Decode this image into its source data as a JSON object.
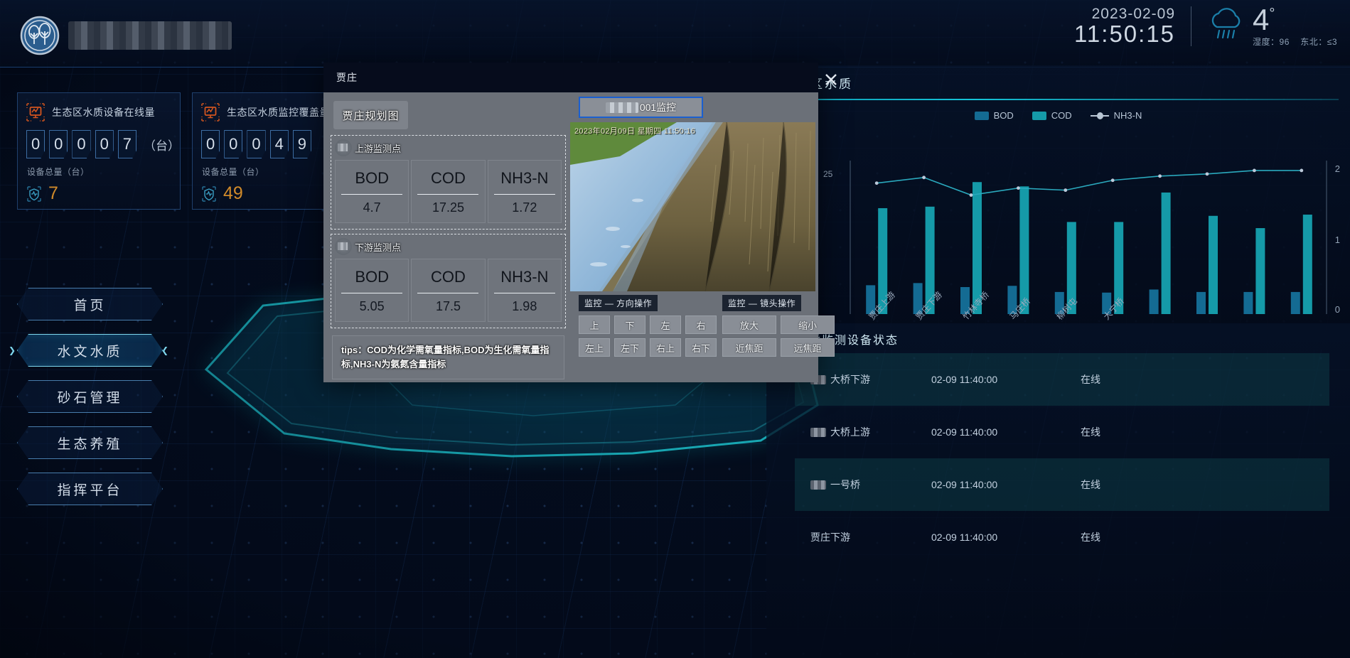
{
  "header": {
    "app_title": "",
    "logo_icon": "tree-logo-icon",
    "date": "2023-02-09",
    "time": "11:50:15",
    "weather_icon": "rain-cloud-icon",
    "temperature": "4",
    "degree": "°",
    "humidity": "湿度：96",
    "wind": "东北：≤3"
  },
  "stat_cards": [
    {
      "icon": "monitor-chart-icon",
      "title": "生态区水质设备在线量",
      "digits": [
        "0",
        "0",
        "0",
        "0",
        "7"
      ],
      "unit": "（台）",
      "sub_label": "设备总量（台）",
      "total_icon": "shield-pulse-icon",
      "total_value": "7"
    },
    {
      "icon": "monitor-chart-icon",
      "title": "生态区水质监控覆盖量",
      "digits": [
        "0",
        "0",
        "0",
        "4",
        "9"
      ],
      "unit": "（台）",
      "sub_label": "设备总量（台）",
      "total_icon": "shield-pulse-icon",
      "total_value": "49"
    }
  ],
  "nav": {
    "items": [
      {
        "label": "首页",
        "active": false
      },
      {
        "label": "水文水质",
        "active": true
      },
      {
        "label": "砂石管理",
        "active": false
      },
      {
        "label": "生态养殖",
        "active": false
      },
      {
        "label": "指挥平台",
        "active": false
      }
    ],
    "arrow_left": "❯",
    "arrow_right": "❮"
  },
  "chart_panel": {
    "icon": "bar-chart-icon",
    "title": "库区水质"
  },
  "chart_data": {
    "type": "bar",
    "title": "库区水质",
    "categories": [
      "贾庄上游",
      "贾庄下游",
      "竹林寺桥",
      "竹林寺桥",
      "马庄桥",
      "马庄桥",
      "柳树屯",
      "柳树屯",
      "大宁桥",
      "大宁桥"
    ],
    "series": [
      {
        "name": "BOD",
        "type": "bar",
        "color": "#146b93",
        "values": [
          4.7,
          5.05,
          4.4,
          4.6,
          3.6,
          3.5,
          4.0,
          3.6,
          3.6,
          3.6
        ]
      },
      {
        "name": "COD",
        "type": "bar",
        "color": "#159aa8",
        "values": [
          17.25,
          17.5,
          21.5,
          20.8,
          15.0,
          15.0,
          19.8,
          16.0,
          14.0,
          16.2
        ]
      },
      {
        "name": "NH3-N",
        "type": "line",
        "color": "#2aa9bd",
        "values": [
          1.72,
          1.8,
          1.55,
          1.65,
          1.62,
          1.76,
          1.82,
          1.85,
          1.9,
          1.9
        ]
      }
    ],
    "ylabel_left": "25",
    "yleft_ticks": [
      "25"
    ],
    "yright_ticks": [
      "0",
      "1",
      "2"
    ],
    "ylim_right": [
      0,
      2
    ],
    "grid": false,
    "legend_position": "top-center",
    "legend": [
      "BOD",
      "COD",
      "NH3-N"
    ]
  },
  "table_panel": {
    "icon": "bar-chart-icon",
    "title": "水质监测设备状态",
    "rows": [
      {
        "name": "大桥下游",
        "time": "02-09 11:40:00",
        "state": "在线",
        "redacted": true
      },
      {
        "name": "大桥上游",
        "time": "02-09 11:40:00",
        "state": "在线",
        "redacted": true
      },
      {
        "name": "一号桥",
        "time": "02-09 11:40:00",
        "state": "在线",
        "redacted": true
      },
      {
        "name": "贾庄下游",
        "time": "02-09 11:40:00",
        "state": "在线",
        "redacted": false
      }
    ]
  },
  "modal": {
    "title": "贾庄",
    "close_icon": "close-icon",
    "plan_button": "贾庄规划图",
    "sections": [
      {
        "label": "上游监测点",
        "marker_icon": "map-pin-icon",
        "metrics": [
          {
            "name": "BOD",
            "value": "4.7"
          },
          {
            "name": "COD",
            "value": "17.25"
          },
          {
            "name": "NH3-N",
            "value": "1.72"
          }
        ]
      },
      {
        "label": "下游监测点",
        "marker_icon": "map-pin-icon",
        "metrics": [
          {
            "name": "BOD",
            "value": "5.05"
          },
          {
            "name": "COD",
            "value": "17.5"
          },
          {
            "name": "NH3-N",
            "value": "1.98"
          }
        ]
      }
    ],
    "tips": "tips：COD为化学需氧量指标,BOD为生化需氧量指标,NH3-N为氨氮含量指标",
    "camera": {
      "button_label": "001监控",
      "osd_text": "2023年02月09日 星期四 11:50:16",
      "direction_group_title": "监控 — 方向操作",
      "lens_group_title": "监控 — 镜头操作",
      "direction_buttons": [
        "上",
        "下",
        "左",
        "右",
        "左上",
        "左下",
        "右上",
        "右下"
      ],
      "lens_buttons": [
        "放大",
        "缩小",
        "近焦距",
        "远焦距"
      ]
    }
  },
  "colors": {
    "accent": "#14c4d8",
    "bod": "#146b93",
    "cod": "#159aa8",
    "nh3n": "#2aa9bd",
    "gold": "#d08a2a",
    "bg": "#040d1e"
  }
}
